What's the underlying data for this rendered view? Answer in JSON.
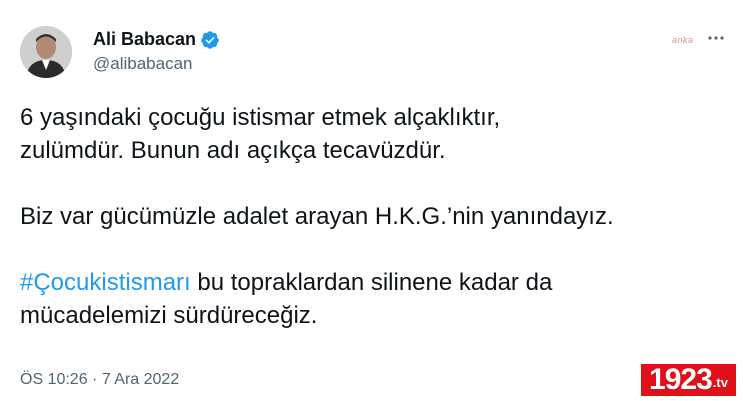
{
  "user": {
    "display_name": "Ali Babacan",
    "handle": "@alibabacan"
  },
  "brand_mark": "anka",
  "tweet": {
    "line1": "6 yaşındaki çocuğu istismar etmek alçaklıktır,",
    "line2": "zulümdür. Bunun adı açıkça tecavüzdür.",
    "line3": "Biz var gücümüzle adalet arayan H.K.G.’nin yanındayız.",
    "hashtag": "#Çocukistismarı",
    "line4_rest": " bu topraklardan silinene kadar da",
    "line5": "mücadelemizi sürdüreceğiz."
  },
  "timestamp": "ÖS 10:26 · 7 Ara 2022",
  "watermark": {
    "number": "1923",
    "tld": ".tv"
  },
  "colors": {
    "accent": "#1d9bf0",
    "watermark": "#e0101a",
    "text": "#0f1419",
    "muted": "#536471"
  },
  "icons": {
    "verified": "verified-badge-icon",
    "more": "more-options-icon"
  }
}
